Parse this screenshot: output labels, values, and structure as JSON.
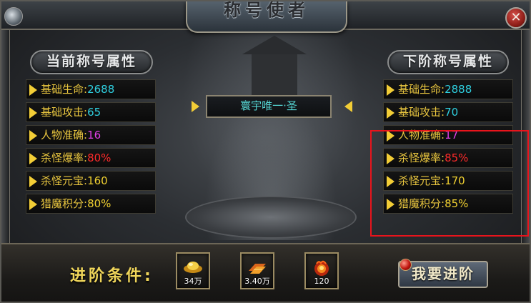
{
  "window": {
    "title": "称号使者",
    "close_label": "✕"
  },
  "current": {
    "header": "当前称号属性",
    "rows": [
      {
        "label": "基础生命:",
        "value": "2688",
        "color": "#2fd0e0"
      },
      {
        "label": "基础攻击:",
        "value": "65",
        "color": "#2fd0e0"
      },
      {
        "label": "人物准确:",
        "value": "16",
        "color": "#e040e8"
      },
      {
        "label": "杀怪爆率:",
        "value": "80%",
        "color": "#ff2a2a"
      },
      {
        "label": "杀怪元宝:",
        "value": "160",
        "color": "#f0d030"
      },
      {
        "label": "猎魔积分:",
        "value": "80%",
        "color": "#f0d030"
      }
    ]
  },
  "next": {
    "header": "下阶称号属性",
    "rows": [
      {
        "label": "基础生命:",
        "value": "2888",
        "color": "#2fd0e0"
      },
      {
        "label": "基础攻击:",
        "value": "70",
        "color": "#2fd0e0"
      },
      {
        "label": "人物准确:",
        "value": "17",
        "color": "#e040e8"
      },
      {
        "label": "杀怪爆率:",
        "value": "85%",
        "color": "#ff2a2a"
      },
      {
        "label": "杀怪元宝:",
        "value": "170",
        "color": "#f0d030"
      },
      {
        "label": "猎魔积分:",
        "value": "85%",
        "color": "#f0d030"
      }
    ]
  },
  "title_name": "寰宇唯一·圣",
  "conditions": {
    "label": "进阶条件:",
    "items": [
      {
        "icon": "gold-ingot-icon",
        "count": "34万"
      },
      {
        "icon": "gold-bars-icon",
        "count": "3.40万"
      },
      {
        "icon": "fire-orb-icon",
        "count": "120"
      }
    ]
  },
  "advance_button": "我要进阶"
}
